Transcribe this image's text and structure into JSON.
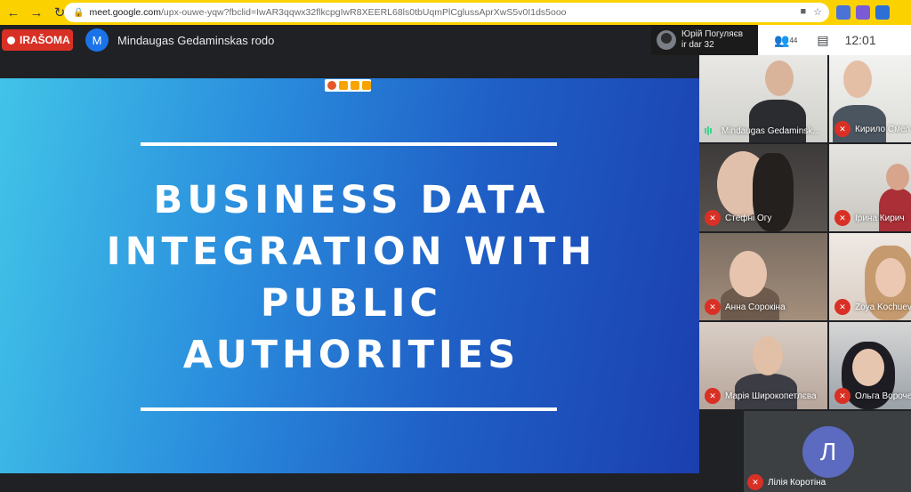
{
  "browser": {
    "back_icon": "←",
    "forward_icon": "→",
    "reload_icon": "↻",
    "url_host": "meet.google.com",
    "url_path": "/upx-ouwe-yqw?fbclid=IwAR3qqwx32flkcpgIwR8XEERL68ls0tbUqmPlCglussAprXwS5v0I1ds5ooo",
    "colors": {
      "bar": "#fbd200"
    }
  },
  "meeting": {
    "recording_label": "IRAŠOMA",
    "presenter_initial": "M",
    "presenter_name": "Mindaugas Gedaminskas rodo",
    "notification": {
      "name": "Юрій Погуляєв",
      "time": "ir dar 32"
    },
    "participant_count": "44",
    "clock": "12:01"
  },
  "slide": {
    "title_lines": [
      "BUSINESS DATA",
      "INTEGRATION WITH",
      "PUBLIC",
      "AUTHORITIES"
    ]
  },
  "participants": [
    {
      "name": "Mindaugas Gedaminsk...",
      "muted": false
    },
    {
      "name": "Кирило Смел",
      "muted": true
    },
    {
      "name": "Стефні Огу",
      "muted": true
    },
    {
      "name": "Ірина Кирич",
      "muted": true
    },
    {
      "name": "Анна Сорокіна",
      "muted": true
    },
    {
      "name": "Zoya Kochuev",
      "muted": true
    },
    {
      "name": "Марія Широкопетлєва",
      "muted": true
    },
    {
      "name": "Ольга Вороче",
      "muted": true
    }
  ],
  "self_tile": {
    "initial": "Л",
    "name": "Лілія Коротіна",
    "muted": true
  }
}
